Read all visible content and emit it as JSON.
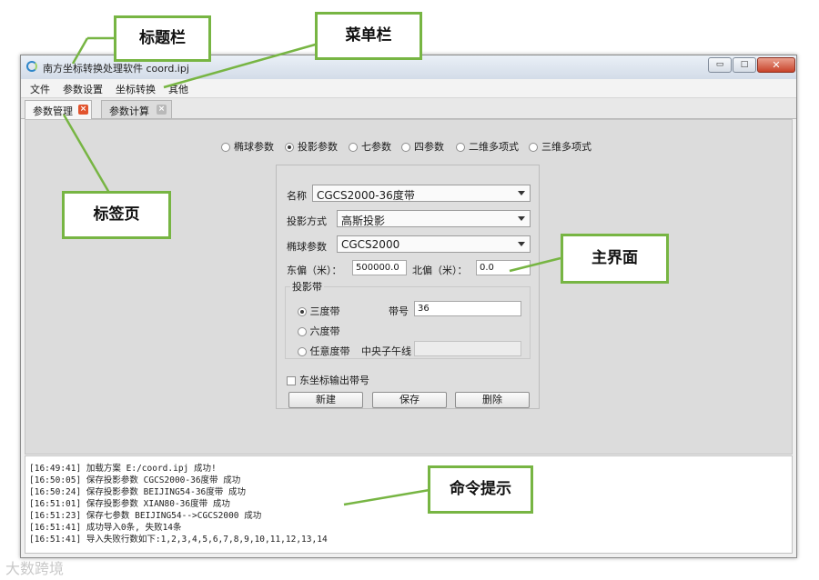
{
  "window": {
    "title": "南方坐标转换处理软件 coord.ipj",
    "controls": {
      "minimize": "▭",
      "maximize": "□",
      "close": "✕"
    }
  },
  "menu": [
    "文件",
    "参数设置",
    "坐标转换",
    "其他"
  ],
  "tabs": [
    {
      "label": "参数管理",
      "active": true,
      "close_color": "#e2542e"
    },
    {
      "label": "参数计算",
      "active": false,
      "close_color": "#b9b9b9"
    }
  ],
  "param_types": {
    "options": [
      "椭球参数",
      "投影参数",
      "七参数",
      "四参数",
      "二维多项式",
      "三维多项式"
    ],
    "selected": "投影参数"
  },
  "form": {
    "name_label": "名称",
    "name_value": "CGCS2000-36度带",
    "projection_label": "投影方式",
    "projection_value": "高斯投影",
    "ellipsoid_label": "椭球参数",
    "ellipsoid_value": "CGCS2000",
    "false_east_label": "东偏（米）：",
    "false_east_value": "500000.0",
    "false_north_label": "北偏（米）：",
    "false_north_value": "0.0",
    "zone_group_title": "投影带",
    "zone_options": [
      "三度带",
      "六度带",
      "任意度带"
    ],
    "zone_selected": "三度带",
    "zone_no_label": "带号",
    "zone_no_value": "36",
    "central_meridian_label": "中央子午线",
    "central_meridian_value": "",
    "output_zone_label": "东坐标输出带号",
    "output_zone_checked": false,
    "buttons": {
      "new": "新建",
      "save": "保存",
      "delete": "删除"
    }
  },
  "console": [
    "[16:49:41] 加载方案 E:/coord.ipj 成功!",
    "[16:50:05] 保存投影参数 CGCS2000-36度带 成功",
    "[16:50:24] 保存投影参数 BEIJING54-36度带 成功",
    "[16:51:01] 保存投影参数 XIAN80-36度带 成功",
    "[16:51:23] 保存七参数 BEIJING54-->CGCS2000 成功",
    "[16:51:41] 成功导入0条, 失败14条",
    "[16:51:41] 导入失败行数如下:1,2,3,4,5,6,7,8,9,10,11,12,13,14"
  ],
  "annotations": {
    "title_bar": "标题栏",
    "menu_bar": "菜单栏",
    "tab_page": "标签页",
    "main_interface": "主界面",
    "command_prompt": "命令提示"
  },
  "watermark": "大数跨境",
  "colors": {
    "callout_border": "#77b543",
    "close_button": "#c8432a"
  }
}
